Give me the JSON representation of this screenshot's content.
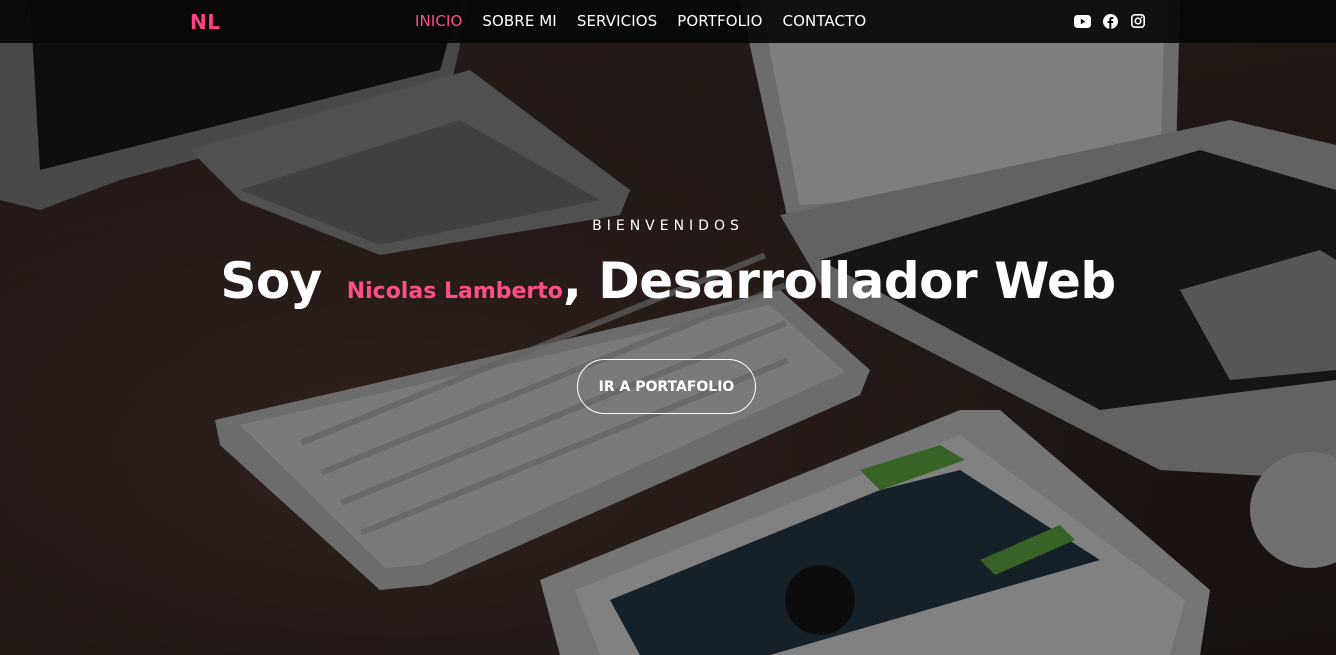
{
  "brand": {
    "logo_text": "NL",
    "color": "#ff3f7f"
  },
  "nav": {
    "items": [
      {
        "label": "INICIO",
        "active": true
      },
      {
        "label": "SOBRE MI",
        "active": false
      },
      {
        "label": "SERVICIOS",
        "active": false
      },
      {
        "label": "PORTFOLIO",
        "active": false
      },
      {
        "label": "CONTACTO",
        "active": false
      }
    ],
    "active_color": "#ff4f88"
  },
  "socials": [
    {
      "icon": "youtube-icon"
    },
    {
      "icon": "facebook-icon"
    },
    {
      "icon": "instagram-icon"
    }
  ],
  "hero": {
    "kicker": "BIENVENIDOS",
    "headline_prefix": "Soy",
    "name": "Nicolas Lamberto",
    "headline_suffix": ", Desarrollador Web",
    "cta_label": "IR A PORTAFOLIO",
    "accent_color": "#ff4f88"
  }
}
